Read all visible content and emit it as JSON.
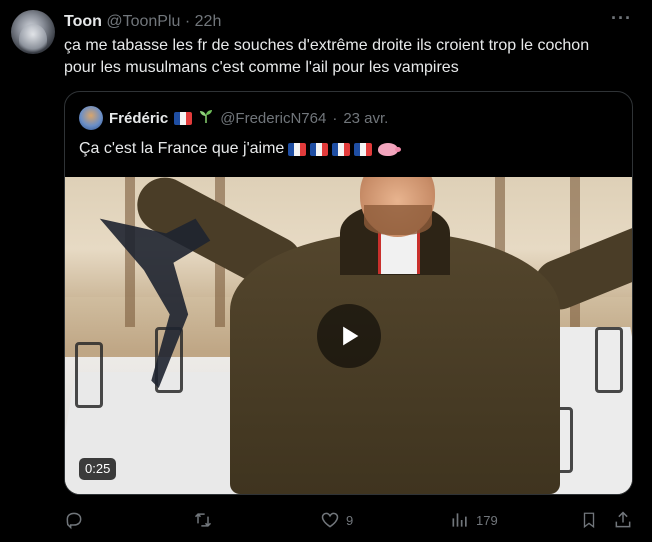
{
  "tweet": {
    "author_name": "Toon",
    "author_handle": "@ToonPlu",
    "separator": " · ",
    "time": "22h",
    "text_line1": "ça me tabasse les fr de souches d'extrême droite ils croient trop le cochon",
    "text_line2": "pour les musulmans c'est comme l'ail pour les vampires",
    "more_label": "···"
  },
  "quote": {
    "author_name": "Frédéric",
    "author_handle": "@FredericN764",
    "separator": " · ",
    "date": "23 avr.",
    "text": "Ça c'est la France que j'aime",
    "video_duration": "0:25"
  },
  "actions": {
    "reply_count": "",
    "retweet_count": "",
    "like_count": "9",
    "view_count": "179"
  },
  "icons": {
    "reply": "reply-icon",
    "retweet": "retweet-icon",
    "like": "heart-icon",
    "views": "views-icon",
    "bookmark": "bookmark-icon",
    "share": "share-icon",
    "play": "play-icon"
  },
  "colors": {
    "background": "#000000",
    "text": "#e7e9ea",
    "muted": "#71767b",
    "border": "#2f3336"
  }
}
